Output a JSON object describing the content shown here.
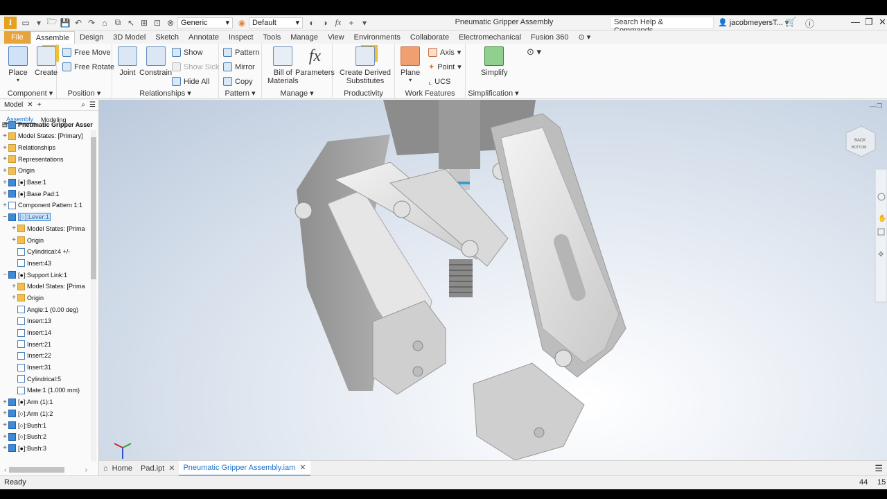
{
  "window_title": "Pneumatic Gripper Assembly",
  "app_logo": "I",
  "qat": {
    "material": "Generic",
    "appearance": "Default"
  },
  "search": {
    "placeholder": "Search Help & Commands..."
  },
  "user": {
    "name": "jacobmeyersT..."
  },
  "tabs": [
    "Assemble",
    "Design",
    "3D Model",
    "Sketch",
    "Annotate",
    "Inspect",
    "Tools",
    "Manage",
    "View",
    "Environments",
    "Collaborate",
    "Electromechanical",
    "Fusion 360"
  ],
  "file_tab": "File",
  "ribbon": {
    "component": {
      "title": "Component",
      "place": "Place",
      "create": "Create"
    },
    "position": {
      "title": "Position",
      "free_move": "Free Move",
      "free_rotate": "Free Rotate"
    },
    "relationships": {
      "title": "Relationships",
      "joint": "Joint",
      "constrain": "Constrain",
      "show": "Show",
      "show_sick": "Show Sick",
      "hide_all": "Hide All"
    },
    "pattern": {
      "title": "Pattern",
      "pattern": "Pattern",
      "mirror": "Mirror",
      "copy": "Copy"
    },
    "manage": {
      "title": "Manage",
      "bom_1": "Bill of",
      "bom_2": "Materials",
      "parameters": "Parameters",
      "fx": "fx"
    },
    "productivity": {
      "title": "Productivity",
      "cds_1": "Create Derived",
      "cds_2": "Substitutes"
    },
    "work_features": {
      "title": "Work Features",
      "plane": "Plane",
      "axis": "Axis",
      "point": "Point",
      "ucs": "UCS"
    },
    "simplification": {
      "title": "Simplification",
      "simplify": "Simplify"
    }
  },
  "browser": {
    "header": "Model",
    "tab_assembly": "Assembly",
    "tab_modeling": "Modeling",
    "root": "Pneumatic Gripper Asser",
    "nodes": [
      "Model States: [Primary]",
      "Relationships",
      "Representations",
      "Origin",
      "[●]:Base:1",
      "[●]:Base Pad:1",
      "Component Pattern 1:1",
      "[○]:Lever:1",
      "Model States: [Prima",
      "Origin",
      "Cylindrical:4 +/-",
      "Insert:43",
      "[●]:Support Link:1",
      "Model States: [Prima",
      "Origin",
      "Angle:1 (0.00 deg)",
      "Insert:13",
      "Insert:14",
      "Insert:21",
      "Insert:22",
      "Insert:31",
      "Cylindrical:5",
      "Mate:1 (1.000 mm)",
      "[●]:Arm (1):1",
      "[○]:Arm (1):2",
      "[○]:Bush:1",
      "[○]:Bush:2",
      "[●]:Bush:3"
    ]
  },
  "viewcube": {
    "face_1": "BACK",
    "face_2": "BOTTOM"
  },
  "doc_tabs": {
    "home": "Home",
    "pad": "Pad.ipt",
    "active": "Pneumatic Gripper Assembly.iam"
  },
  "status": {
    "text": "Ready",
    "num1": "44",
    "num2": "15"
  }
}
